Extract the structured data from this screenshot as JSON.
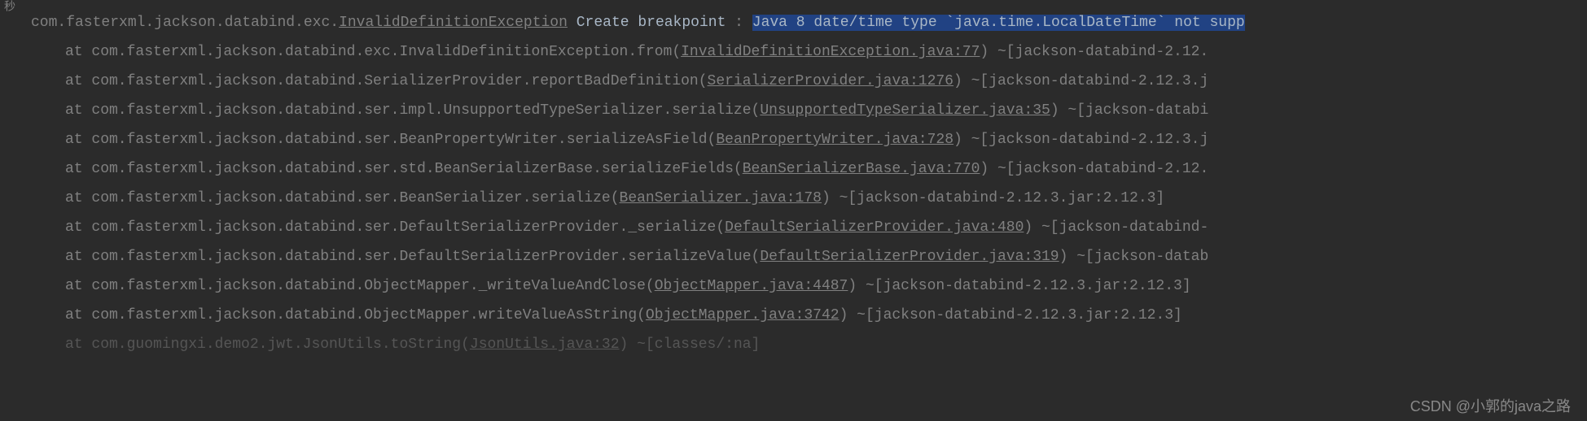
{
  "sidebar": {
    "text": "秒"
  },
  "stacktrace": {
    "line0": {
      "prefix": "com.fasterxml.jackson.databind.exc.",
      "exception_link": "InvalidDefinitionException",
      "create_bp": "Create breakpoint",
      "colon": " : ",
      "highlighted": "Java 8 date/time type `java.time.LocalDateTime` not supp"
    },
    "line1": {
      "at": "at com.fasterxml.jackson.databind.exc.InvalidDefinitionException.from(",
      "link": "InvalidDefinitionException.java:77",
      "suffix": ") ~[jackson-databind-2.12."
    },
    "line2": {
      "at": "at com.fasterxml.jackson.databind.SerializerProvider.reportBadDefinition(",
      "link": "SerializerProvider.java:1276",
      "suffix": ") ~[jackson-databind-2.12.3.j"
    },
    "line3": {
      "at": "at com.fasterxml.jackson.databind.ser.impl.UnsupportedTypeSerializer.serialize(",
      "link": "UnsupportedTypeSerializer.java:35",
      "suffix": ") ~[jackson-databi"
    },
    "line4": {
      "at": "at com.fasterxml.jackson.databind.ser.BeanPropertyWriter.serializeAsField(",
      "link": "BeanPropertyWriter.java:728",
      "suffix": ") ~[jackson-databind-2.12.3.j"
    },
    "line5": {
      "at": "at com.fasterxml.jackson.databind.ser.std.BeanSerializerBase.serializeFields(",
      "link": "BeanSerializerBase.java:770",
      "suffix": ") ~[jackson-databind-2.12."
    },
    "line6": {
      "at": "at com.fasterxml.jackson.databind.ser.BeanSerializer.serialize(",
      "link": "BeanSerializer.java:178",
      "suffix": ") ~[jackson-databind-2.12.3.jar:2.12.3]"
    },
    "line7": {
      "at": "at com.fasterxml.jackson.databind.ser.DefaultSerializerProvider._serialize(",
      "link": "DefaultSerializerProvider.java:480",
      "suffix": ") ~[jackson-databind-"
    },
    "line8": {
      "at": "at com.fasterxml.jackson.databind.ser.DefaultSerializerProvider.serializeValue(",
      "link": "DefaultSerializerProvider.java:319",
      "suffix": ") ~[jackson-datab"
    },
    "line9": {
      "at": "at com.fasterxml.jackson.databind.ObjectMapper._writeValueAndClose(",
      "link": "ObjectMapper.java:4487",
      "suffix": ") ~[jackson-databind-2.12.3.jar:2.12.3]"
    },
    "line10": {
      "at": "at com.fasterxml.jackson.databind.ObjectMapper.writeValueAsString(",
      "link": "ObjectMapper.java:3742",
      "suffix": ") ~[jackson-databind-2.12.3.jar:2.12.3]"
    },
    "line11": {
      "at": "at com.guomingxi.demo2.jwt.JsonUtils.toString(",
      "link": "JsonUtils.java:32",
      "suffix": ") ~[classes/:na]"
    }
  },
  "watermark": "CSDN @小郭的java之路"
}
